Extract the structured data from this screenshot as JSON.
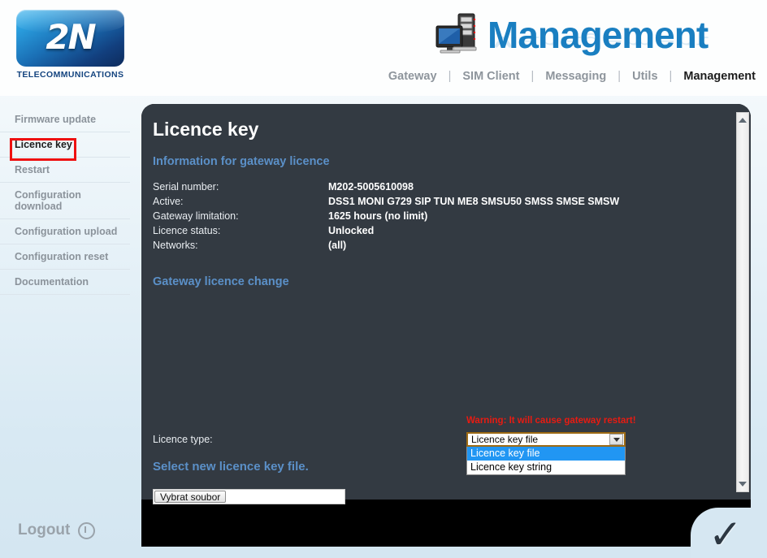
{
  "brand": {
    "logo_text": "2N",
    "logo_caption": "TELECOMMUNICATIONS",
    "section_title": "Management",
    "section_icon": "desktop-computer-icon"
  },
  "topnav": {
    "separator": "|",
    "items": [
      {
        "label": "Gateway",
        "active": false
      },
      {
        "label": "SIM Client",
        "active": false
      },
      {
        "label": "Messaging",
        "active": false
      },
      {
        "label": "Utils",
        "active": false
      },
      {
        "label": "Management",
        "active": true
      }
    ]
  },
  "sidebar": {
    "items": [
      {
        "label": "Firmware update",
        "selected": false
      },
      {
        "label": "Licence key",
        "selected": true
      },
      {
        "label": "Restart",
        "selected": false
      },
      {
        "label": "Configuration download",
        "selected": false
      },
      {
        "label": "Configuration upload",
        "selected": false
      },
      {
        "label": "Configuration reset",
        "selected": false
      },
      {
        "label": "Documentation",
        "selected": false
      }
    ],
    "highlight_color": "#ee1111"
  },
  "logout": {
    "label": "Logout",
    "icon": "power-icon"
  },
  "panel": {
    "title": "Licence key",
    "info_heading": "Information for gateway licence",
    "info_rows": [
      {
        "label": "Serial number:",
        "value": "M202-5005610098"
      },
      {
        "label": "Active:",
        "value": "DSS1 MONI G729 SIP TUN ME8 SMSU50 SMSS SMSE SMSW"
      },
      {
        "label": "Gateway limitation:",
        "value": "1625 hours (no limit)"
      },
      {
        "label": "Licence status:",
        "value": "Unlocked"
      },
      {
        "label": "Networks:",
        "value": "(all)"
      }
    ],
    "change_heading": "Gateway licence change",
    "warning": "Warning: It will cause gateway restart!",
    "warning_color": "#e81b12",
    "licence_type_label": "Licence type:",
    "licence_type_value": "Licence key file",
    "licence_type_options": [
      {
        "label": "Licence key file",
        "highlighted": true
      },
      {
        "label": "Licence key string",
        "highlighted": false
      }
    ],
    "select_caret": "chevron-down-icon",
    "pick_file_label": "Select new licence key file.",
    "file_button_label": "Vybrat soubor",
    "file_name": "",
    "accent_color": "#5b90c8",
    "panel_bg": "#333a42"
  },
  "scrollbar": {
    "up_icon": "triangle-up-icon",
    "down_icon": "triangle-down-icon"
  },
  "footer": {
    "check_icon": "check-mark-icon",
    "check_glyph": "✓"
  }
}
